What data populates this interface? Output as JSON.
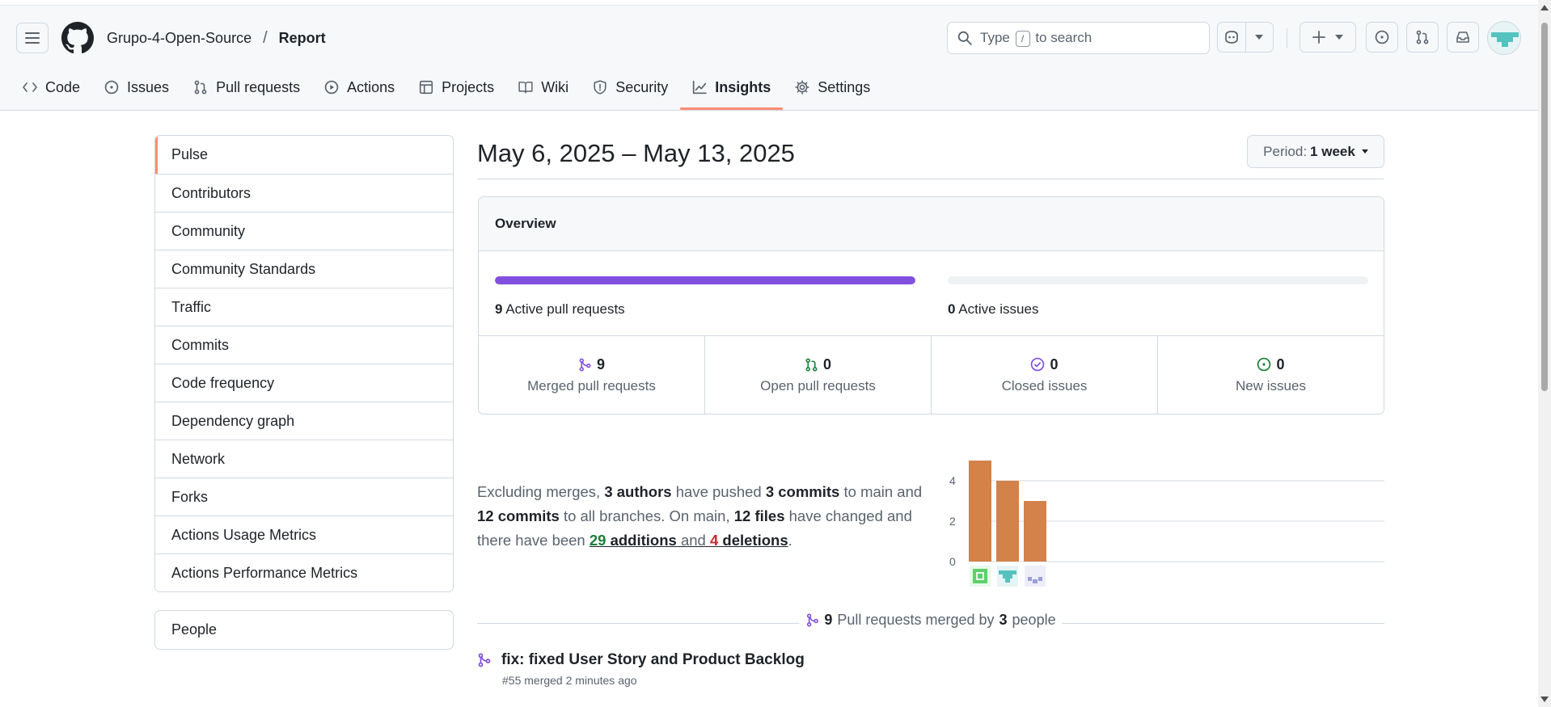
{
  "header": {
    "owner": "Grupo-4-Open-Source",
    "separator": "/",
    "repo": "Report",
    "search": {
      "prefix": "Type",
      "key": "/",
      "suffix": "to search"
    }
  },
  "tabs": [
    {
      "label": "Code",
      "icon": "code-icon"
    },
    {
      "label": "Issues",
      "icon": "issue-opened-icon"
    },
    {
      "label": "Pull requests",
      "icon": "git-pull-request-icon"
    },
    {
      "label": "Actions",
      "icon": "play-icon"
    },
    {
      "label": "Projects",
      "icon": "table-icon"
    },
    {
      "label": "Wiki",
      "icon": "book-icon"
    },
    {
      "label": "Security",
      "icon": "shield-icon"
    },
    {
      "label": "Insights",
      "icon": "graph-icon",
      "selected": true
    },
    {
      "label": "Settings",
      "icon": "gear-icon"
    }
  ],
  "sidebar": {
    "items": [
      "Pulse",
      "Contributors",
      "Community",
      "Community Standards",
      "Traffic",
      "Commits",
      "Code frequency",
      "Dependency graph",
      "Network",
      "Forks",
      "Actions Usage Metrics",
      "Actions Performance Metrics"
    ],
    "selected": "Pulse",
    "secondary": [
      "People"
    ]
  },
  "main": {
    "title": "May 6, 2025 – May 13, 2025",
    "period": {
      "label": "Period:",
      "value": "1 week"
    },
    "overview": {
      "heading": "Overview",
      "active_prs": {
        "count": "9",
        "label": "Active pull requests",
        "fill_fraction": 1.0
      },
      "active_issues": {
        "count": "0",
        "label": "Active issues",
        "fill_fraction": 0.0
      },
      "stats": [
        {
          "num": "9",
          "label": "Merged pull requests",
          "icon": "git-merge-icon",
          "color": "#8250df"
        },
        {
          "num": "0",
          "label": "Open pull requests",
          "icon": "git-pull-request-icon",
          "color": "#1a7f37"
        },
        {
          "num": "0",
          "label": "Closed issues",
          "icon": "issue-closed-icon",
          "color": "#8250df"
        },
        {
          "num": "0",
          "label": "New issues",
          "icon": "issue-opened-icon",
          "color": "#1a7f37"
        }
      ]
    },
    "summary": {
      "t1": "Excluding merges,",
      "authors": "3 authors",
      "t2": "have pushed",
      "commits_main": "3 commits",
      "t3": "to main and",
      "commits_all": "12 commits",
      "t4": "to all branches. On main,",
      "files": "12 files",
      "t5": "have changed and there have been",
      "additions_num": "29",
      "additions_word": "additions",
      "t6": "and",
      "deletions_num": "4",
      "deletions_word": "deletions",
      "t7": "."
    },
    "merged_summary": {
      "count": "9",
      "t1": "Pull requests merged by",
      "people": "3",
      "t2": "people"
    },
    "pull_requests": [
      {
        "title": "fix: fixed User Story and Product Backlog",
        "meta": "#55 merged 2 minutes ago"
      }
    ]
  },
  "chart_data": {
    "type": "bar",
    "categories": [
      "",
      "",
      ""
    ],
    "values": [
      5,
      4,
      3
    ],
    "ylim": [
      0,
      5
    ],
    "yticks": [
      "0",
      "2",
      "4"
    ],
    "bar_color": "#d3824a",
    "grid": true
  },
  "colors": {
    "accent": "#fd8c73",
    "purple": "#8250df",
    "green": "#1a7f37",
    "red": "#d1242f"
  }
}
